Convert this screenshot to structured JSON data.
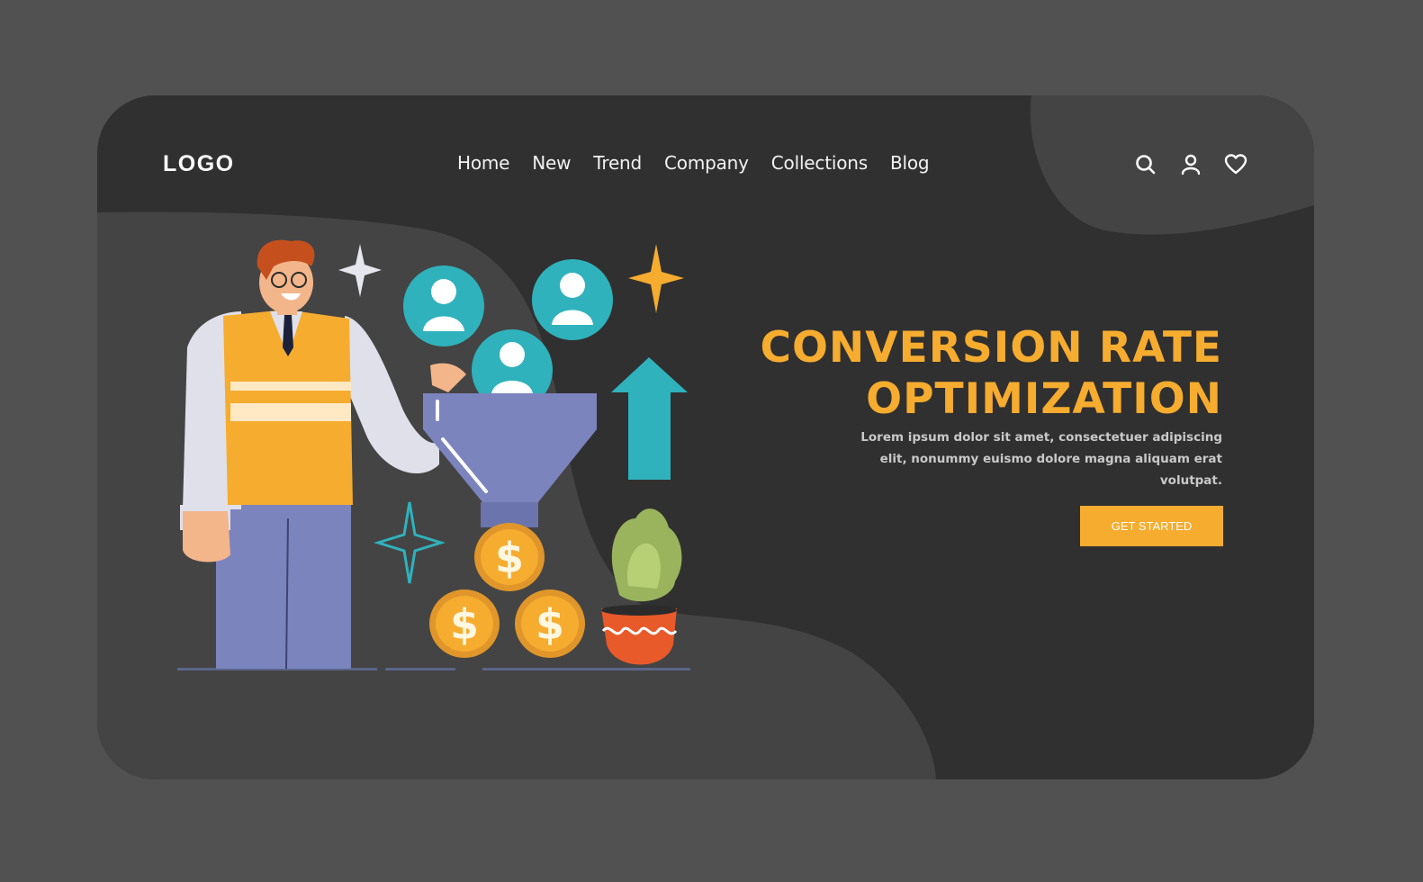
{
  "header": {
    "logo": "LOGO",
    "nav": [
      {
        "label": "Home"
      },
      {
        "label": "New"
      },
      {
        "label": "Trend"
      },
      {
        "label": "Company"
      },
      {
        "label": "Collections"
      },
      {
        "label": "Blog"
      }
    ],
    "icons": [
      "search-icon",
      "user-icon",
      "heart-icon"
    ]
  },
  "hero": {
    "title_line1": "CONVERSION RATE",
    "title_line2": "OPTIMIZATION",
    "description": "Lorem ipsum dolor sit amet, consectetuer adipiscing elit, nonummy euismo dolore magna aliquam erat volutpat.",
    "cta_label": "GET STARTED"
  },
  "illustration": {
    "subject": "man pouring user avatars into funnel producing dollar coins",
    "coin_symbol": "$"
  },
  "colors": {
    "page_bg": "#515151",
    "card_bg": "#303030",
    "blob": "#444444",
    "accent": "#f6ac2f",
    "teal": "#2fb2bc",
    "funnel": "#7b84bd"
  }
}
